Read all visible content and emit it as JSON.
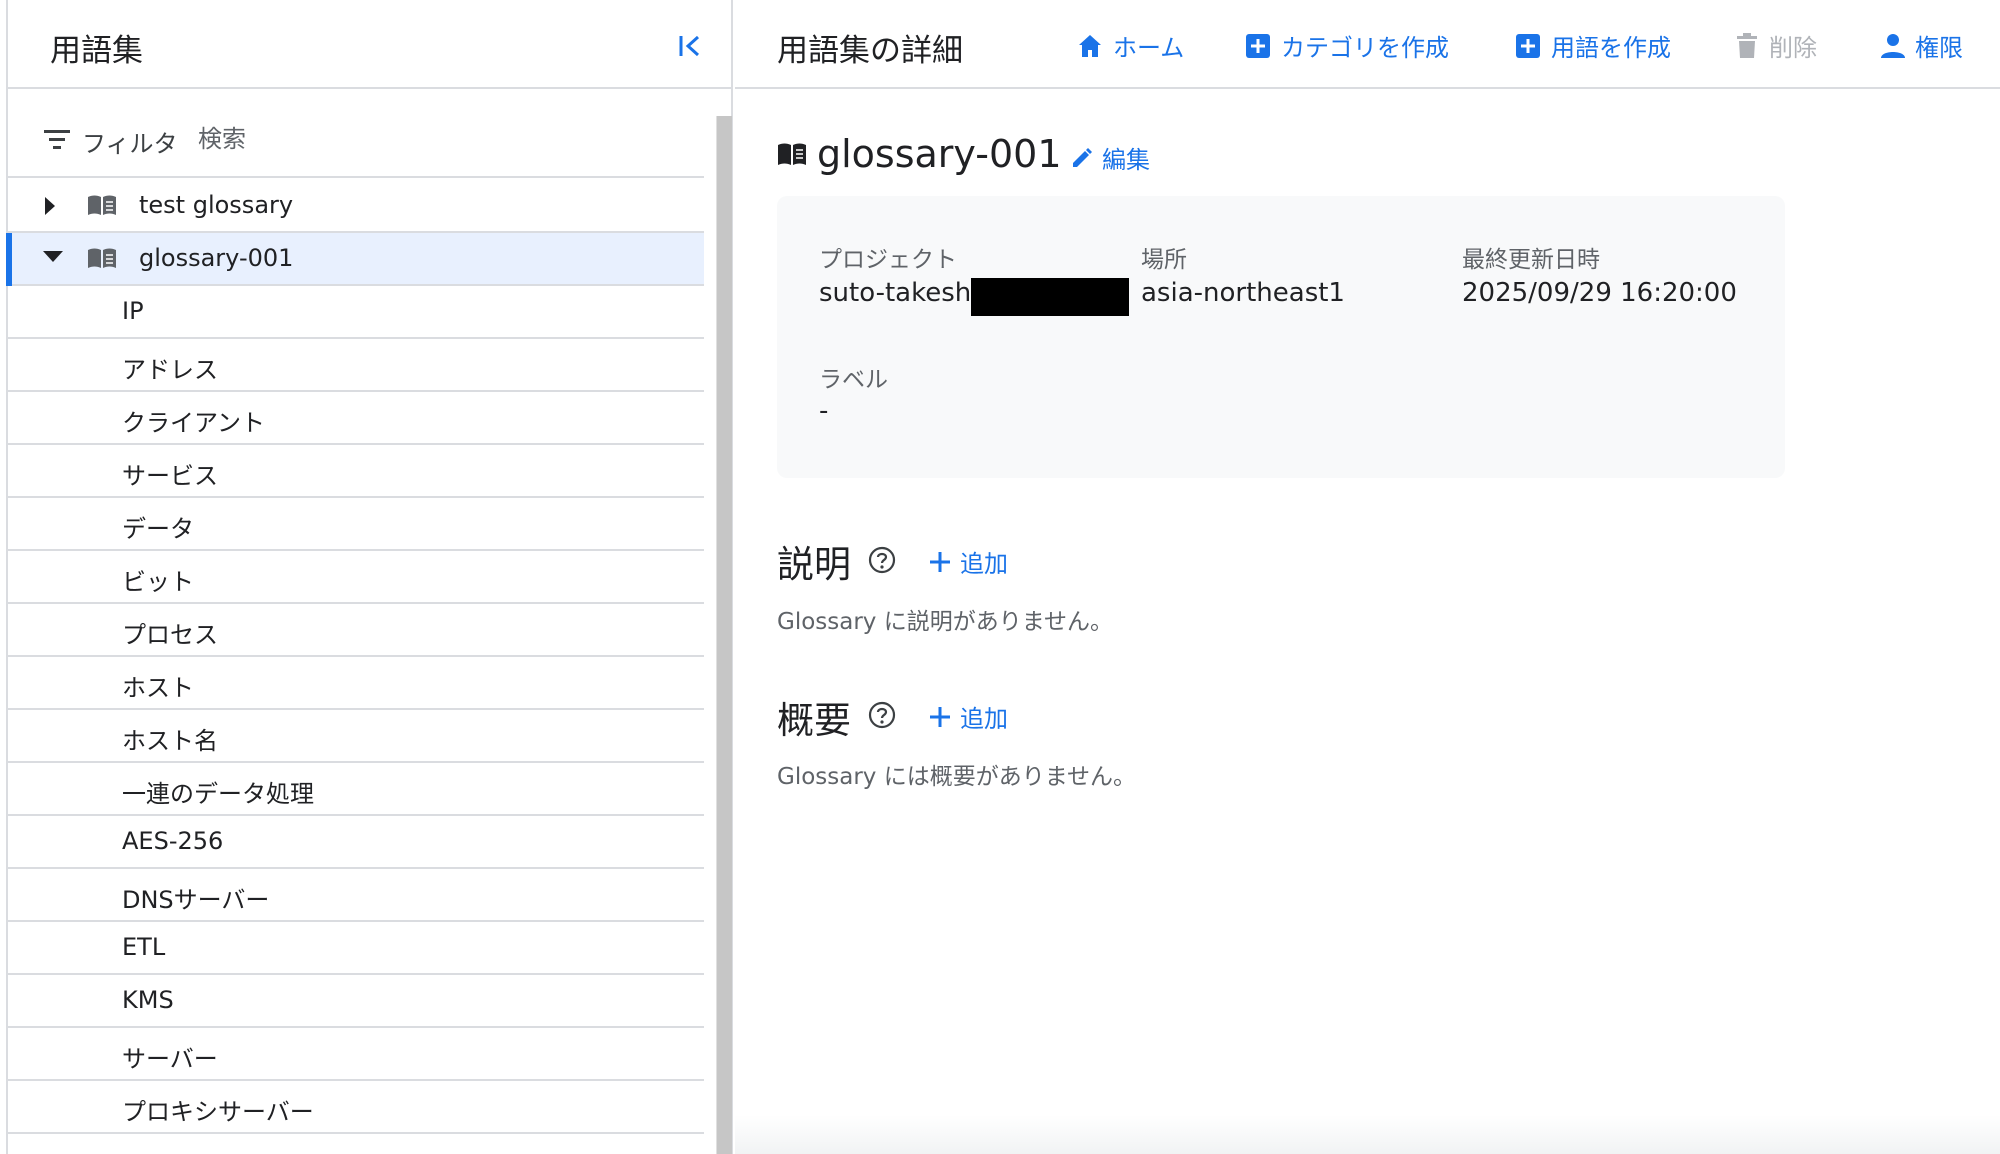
{
  "left_panel": {
    "title": "用語集",
    "filter_label": "フィルタ",
    "search_placeholder": "検索",
    "glossaries": [
      {
        "label": "test glossary",
        "expanded": false,
        "selected": false
      },
      {
        "label": "glossary-001",
        "expanded": true,
        "selected": true
      }
    ],
    "terms": [
      "IP",
      "アドレス",
      "クライアント",
      "サービス",
      "データ",
      "ビット",
      "プロセス",
      "ホスト",
      "ホスト名",
      "一連のデータ処理",
      "AES-256",
      "DNSサーバー",
      "ETL",
      "KMS",
      "サーバー",
      "プロキシサーバー"
    ]
  },
  "header": {
    "title": "用語集の詳細",
    "actions": {
      "home": "ホーム",
      "create_category": "カテゴリを作成",
      "create_term": "用語を作成",
      "delete": "削除",
      "permissions": "権限"
    }
  },
  "detail": {
    "name": "glossary-001",
    "edit": "編集",
    "project_label": "プロジェクト",
    "project_value": "suto-takeshi",
    "location_label": "場所",
    "location_value": "asia-northeast1",
    "updated_label": "最終更新日時",
    "updated_value": "2025/09/29 16:20:00",
    "labels_label": "ラベル",
    "labels_value": "-"
  },
  "description": {
    "title": "説明",
    "add": "追加",
    "empty": "Glossary に説明がありません。"
  },
  "overview": {
    "title": "概要",
    "add": "追加",
    "empty": "Glossary には概要がありません。"
  },
  "colors": {
    "accent": "#1a73e8",
    "selected_bg": "#e8f0fe",
    "card_bg": "#f8f9fa",
    "disabled": "#b0b3b8"
  }
}
